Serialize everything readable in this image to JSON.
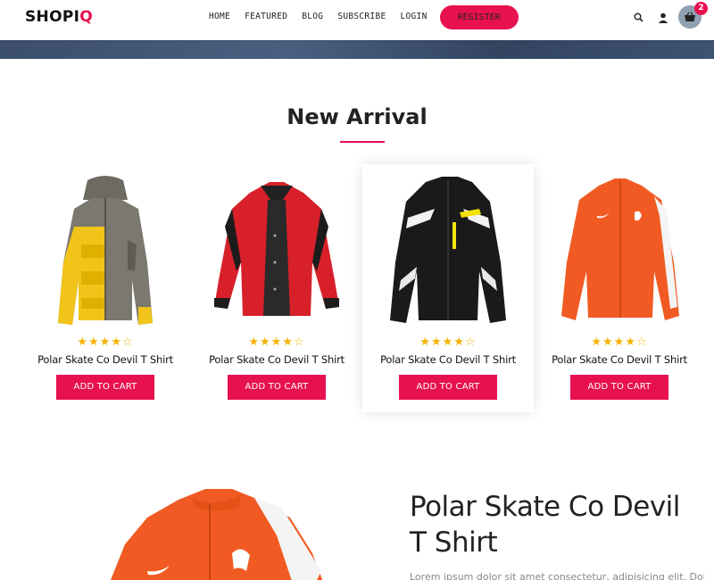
{
  "header": {
    "logo_main": "SHOPI",
    "logo_accent": "Q",
    "nav": [
      "HOME",
      "FEATURED",
      "BLOG",
      "SUBSCRIBE",
      "LOGIN"
    ],
    "register_label": "REGISTER",
    "cart_count": "2",
    "icons": [
      "search-icon",
      "user-icon",
      "basket-icon"
    ]
  },
  "section": {
    "title": "New Arrival"
  },
  "products": [
    {
      "name": "Polar Skate Co Devil T Shirt",
      "rating": 4,
      "rating_max": 5,
      "cta": "ADD TO CART",
      "image": "yellow-gray-puffer-jacket"
    },
    {
      "name": "Polar Skate Co Devil T Shirt",
      "rating": 4,
      "rating_max": 5,
      "cta": "ADD TO CART",
      "image": "red-black-ski-jacket"
    },
    {
      "name": "Polar Skate Co Devil T Shirt",
      "rating": 4,
      "rating_max": 5,
      "cta": "ADD TO CART",
      "image": "black-white-moto-jacket"
    },
    {
      "name": "Polar Skate Co Devil T Shirt",
      "rating": 4,
      "rating_max": 5,
      "cta": "ADD TO CART",
      "image": "orange-track-jacket"
    }
  ],
  "feature": {
    "title": "Polar Skate Co Devil T Shirt",
    "description": "Lorem ipsum dolor sit amet consectetur, adipisicing elit. Doloremque"
  },
  "colors": {
    "accent": "#e8114f",
    "star": "#f5b301",
    "banner": "#3e5272"
  }
}
